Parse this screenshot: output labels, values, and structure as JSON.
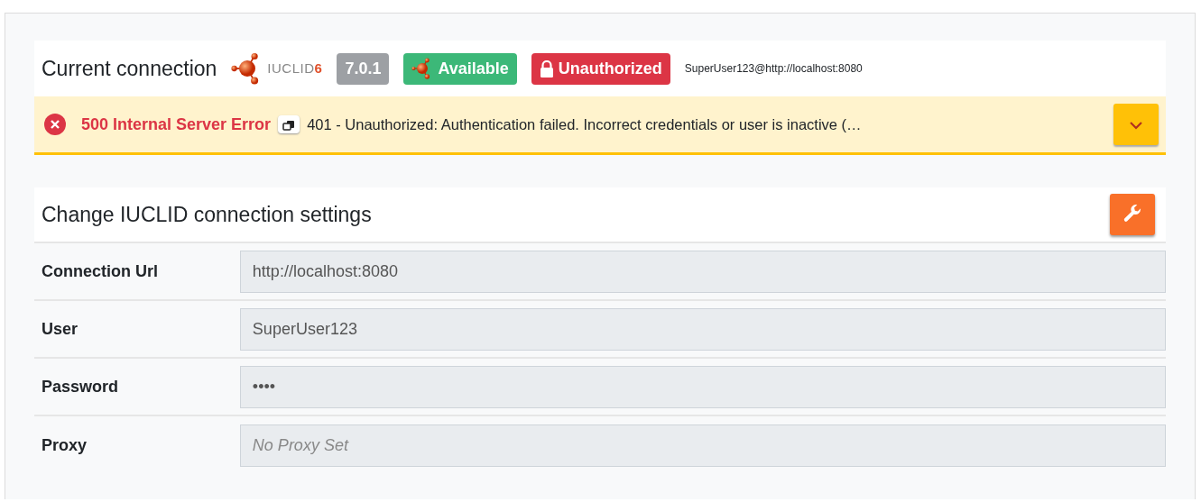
{
  "connection": {
    "title": "Current connection",
    "logo": {
      "name": "IUCLID",
      "number": "6"
    },
    "badges": [
      {
        "text": "7.0.1",
        "kind": "version"
      },
      {
        "text": "Available",
        "kind": "available"
      },
      {
        "text": "Unauthorized",
        "kind": "unauthorized"
      }
    ],
    "address": "SuperUser123@http://localhost:8080"
  },
  "alert": {
    "status": "500 Internal Server Error",
    "message": "401 - Unauthorized: Authentication failed. Incorrect credentials or user is inactive (…",
    "expanded": false
  },
  "settings": {
    "title": "Change IUCLID connection settings",
    "fields": [
      {
        "label": "Connection Url",
        "value": "http://localhost:8080"
      },
      {
        "label": "User",
        "value": "SuperUser123"
      },
      {
        "label": "Password",
        "value": "••••"
      },
      {
        "label": "Proxy",
        "placeholder": "No Proxy Set"
      }
    ]
  }
}
